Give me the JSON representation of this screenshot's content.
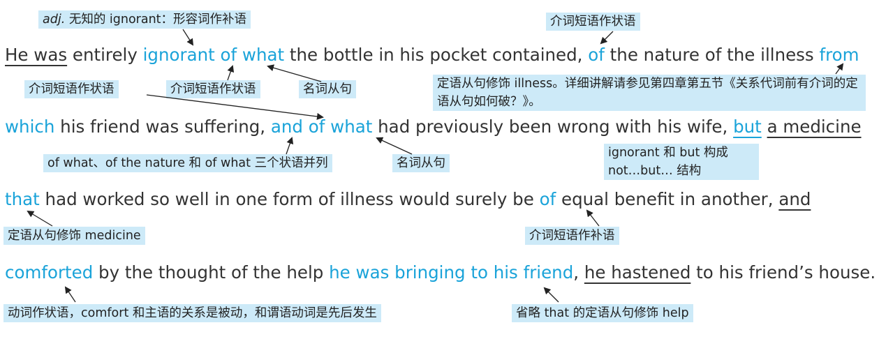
{
  "sentence": {
    "line1": [
      {
        "t": "He was",
        "c": "ul"
      },
      {
        "t": " entirely ",
        "c": ""
      },
      {
        "t": "ignorant of what",
        "c": "hl"
      },
      {
        "t": " the bottle in his pocket contained, ",
        "c": ""
      },
      {
        "t": "of",
        "c": "hl"
      },
      {
        "t": " the nature of the illness ",
        "c": ""
      },
      {
        "t": "from",
        "c": "hl"
      }
    ],
    "line2": [
      {
        "t": "which",
        "c": "hl"
      },
      {
        "t": " his friend was suffering, ",
        "c": ""
      },
      {
        "t": "and of what",
        "c": "hl"
      },
      {
        "t": " had previously been wrong with his wife, ",
        "c": ""
      },
      {
        "t": "but",
        "c": "hl ul"
      },
      {
        "t": " ",
        "c": ""
      },
      {
        "t": "a medicine",
        "c": "ul"
      }
    ],
    "line3": [
      {
        "t": "that",
        "c": "hl"
      },
      {
        "t": " had worked so well in one form of illness would surely be ",
        "c": ""
      },
      {
        "t": "of",
        "c": "hl"
      },
      {
        "t": " equal benefit in another, ",
        "c": ""
      },
      {
        "t": "and",
        "c": "ul"
      }
    ],
    "line4": [
      {
        "t": "comforted",
        "c": "hl"
      },
      {
        "t": " by the thought of the help ",
        "c": ""
      },
      {
        "t": "he was bringing to his friend",
        "c": "hl"
      },
      {
        "t": ", ",
        "c": ""
      },
      {
        "t": "he hastened",
        "c": "ul"
      },
      {
        "t": " to his friend’s house.",
        "c": ""
      }
    ]
  },
  "notes": {
    "adj_prefix": "adj.",
    "adj_rest": " 无知的 ignorant：形容词作补语",
    "prep_adverbial_top": "介词短语作状语",
    "prep_adverbial_left": "介词短语作状语",
    "prep_adverbial_mid": "介词短语作状语",
    "noun_clause_1": "名词从句",
    "attrib_illness": "定语从句修饰 illness。详细讲解请参见第四章第五节《关系代词前有介词的定语从句如何破？》。",
    "three_adverbials": "of what、of the nature 和 of what 三个状语并列",
    "noun_clause_2": "名词从句",
    "not_but": "ignorant 和 but 构成 not…but… 结构",
    "attrib_medicine": "定语从句修饰 medicine",
    "prep_complement": "介词短语作补语",
    "verb_adverbial": "动词作状语，comfort 和主语的关系是被动，和谓语动词是先后发生",
    "omit_that": "省略 that 的定语从句修饰 help"
  },
  "colors": {
    "highlight_text": "#1aa3d9",
    "note_background": "#cdeaf8",
    "body_text": "#333333"
  }
}
